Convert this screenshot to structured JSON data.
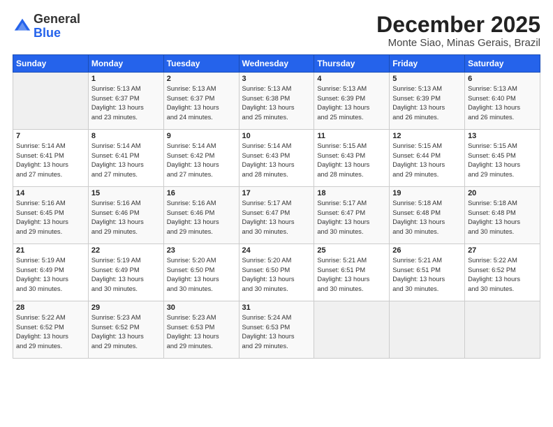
{
  "logo": {
    "general": "General",
    "blue": "Blue"
  },
  "title": "December 2025",
  "location": "Monte Siao, Minas Gerais, Brazil",
  "days_of_week": [
    "Sunday",
    "Monday",
    "Tuesday",
    "Wednesday",
    "Thursday",
    "Friday",
    "Saturday"
  ],
  "weeks": [
    [
      {
        "day": "",
        "info": ""
      },
      {
        "day": "1",
        "info": "Sunrise: 5:13 AM\nSunset: 6:37 PM\nDaylight: 13 hours\nand 23 minutes."
      },
      {
        "day": "2",
        "info": "Sunrise: 5:13 AM\nSunset: 6:37 PM\nDaylight: 13 hours\nand 24 minutes."
      },
      {
        "day": "3",
        "info": "Sunrise: 5:13 AM\nSunset: 6:38 PM\nDaylight: 13 hours\nand 25 minutes."
      },
      {
        "day": "4",
        "info": "Sunrise: 5:13 AM\nSunset: 6:39 PM\nDaylight: 13 hours\nand 25 minutes."
      },
      {
        "day": "5",
        "info": "Sunrise: 5:13 AM\nSunset: 6:39 PM\nDaylight: 13 hours\nand 26 minutes."
      },
      {
        "day": "6",
        "info": "Sunrise: 5:13 AM\nSunset: 6:40 PM\nDaylight: 13 hours\nand 26 minutes."
      }
    ],
    [
      {
        "day": "7",
        "info": "Sunrise: 5:14 AM\nSunset: 6:41 PM\nDaylight: 13 hours\nand 27 minutes."
      },
      {
        "day": "8",
        "info": "Sunrise: 5:14 AM\nSunset: 6:41 PM\nDaylight: 13 hours\nand 27 minutes."
      },
      {
        "day": "9",
        "info": "Sunrise: 5:14 AM\nSunset: 6:42 PM\nDaylight: 13 hours\nand 27 minutes."
      },
      {
        "day": "10",
        "info": "Sunrise: 5:14 AM\nSunset: 6:43 PM\nDaylight: 13 hours\nand 28 minutes."
      },
      {
        "day": "11",
        "info": "Sunrise: 5:15 AM\nSunset: 6:43 PM\nDaylight: 13 hours\nand 28 minutes."
      },
      {
        "day": "12",
        "info": "Sunrise: 5:15 AM\nSunset: 6:44 PM\nDaylight: 13 hours\nand 29 minutes."
      },
      {
        "day": "13",
        "info": "Sunrise: 5:15 AM\nSunset: 6:45 PM\nDaylight: 13 hours\nand 29 minutes."
      }
    ],
    [
      {
        "day": "14",
        "info": "Sunrise: 5:16 AM\nSunset: 6:45 PM\nDaylight: 13 hours\nand 29 minutes."
      },
      {
        "day": "15",
        "info": "Sunrise: 5:16 AM\nSunset: 6:46 PM\nDaylight: 13 hours\nand 29 minutes."
      },
      {
        "day": "16",
        "info": "Sunrise: 5:16 AM\nSunset: 6:46 PM\nDaylight: 13 hours\nand 29 minutes."
      },
      {
        "day": "17",
        "info": "Sunrise: 5:17 AM\nSunset: 6:47 PM\nDaylight: 13 hours\nand 30 minutes."
      },
      {
        "day": "18",
        "info": "Sunrise: 5:17 AM\nSunset: 6:47 PM\nDaylight: 13 hours\nand 30 minutes."
      },
      {
        "day": "19",
        "info": "Sunrise: 5:18 AM\nSunset: 6:48 PM\nDaylight: 13 hours\nand 30 minutes."
      },
      {
        "day": "20",
        "info": "Sunrise: 5:18 AM\nSunset: 6:48 PM\nDaylight: 13 hours\nand 30 minutes."
      }
    ],
    [
      {
        "day": "21",
        "info": "Sunrise: 5:19 AM\nSunset: 6:49 PM\nDaylight: 13 hours\nand 30 minutes."
      },
      {
        "day": "22",
        "info": "Sunrise: 5:19 AM\nSunset: 6:49 PM\nDaylight: 13 hours\nand 30 minutes."
      },
      {
        "day": "23",
        "info": "Sunrise: 5:20 AM\nSunset: 6:50 PM\nDaylight: 13 hours\nand 30 minutes."
      },
      {
        "day": "24",
        "info": "Sunrise: 5:20 AM\nSunset: 6:50 PM\nDaylight: 13 hours\nand 30 minutes."
      },
      {
        "day": "25",
        "info": "Sunrise: 5:21 AM\nSunset: 6:51 PM\nDaylight: 13 hours\nand 30 minutes."
      },
      {
        "day": "26",
        "info": "Sunrise: 5:21 AM\nSunset: 6:51 PM\nDaylight: 13 hours\nand 30 minutes."
      },
      {
        "day": "27",
        "info": "Sunrise: 5:22 AM\nSunset: 6:52 PM\nDaylight: 13 hours\nand 30 minutes."
      }
    ],
    [
      {
        "day": "28",
        "info": "Sunrise: 5:22 AM\nSunset: 6:52 PM\nDaylight: 13 hours\nand 29 minutes."
      },
      {
        "day": "29",
        "info": "Sunrise: 5:23 AM\nSunset: 6:52 PM\nDaylight: 13 hours\nand 29 minutes."
      },
      {
        "day": "30",
        "info": "Sunrise: 5:23 AM\nSunset: 6:53 PM\nDaylight: 13 hours\nand 29 minutes."
      },
      {
        "day": "31",
        "info": "Sunrise: 5:24 AM\nSunset: 6:53 PM\nDaylight: 13 hours\nand 29 minutes."
      },
      {
        "day": "",
        "info": ""
      },
      {
        "day": "",
        "info": ""
      },
      {
        "day": "",
        "info": ""
      }
    ]
  ]
}
